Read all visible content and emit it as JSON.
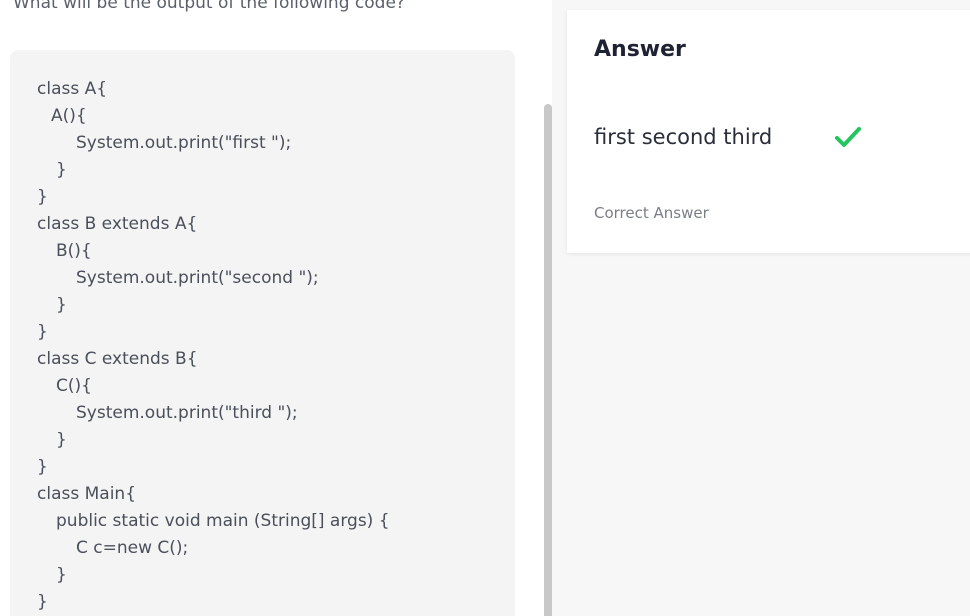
{
  "question": {
    "text": "What will be the output of the following code?"
  },
  "code": {
    "lines": [
      "class A{",
      "A(){",
      "System.out.print(\"first \");",
      "}",
      "}",
      "class B extends A{",
      "B(){",
      "System.out.print(\"second \");",
      "}",
      "}",
      "class C extends B{",
      "C(){",
      "System.out.print(\"third \");",
      "}",
      "}",
      "class Main{",
      "public static void main (String[] args) {",
      "C c=new C();",
      "}",
      "}"
    ]
  },
  "answer_card": {
    "title": "Answer",
    "answer": "first second third",
    "status_icon": "check-icon",
    "status_label": "Correct Answer",
    "check_color": "#22c55e"
  }
}
